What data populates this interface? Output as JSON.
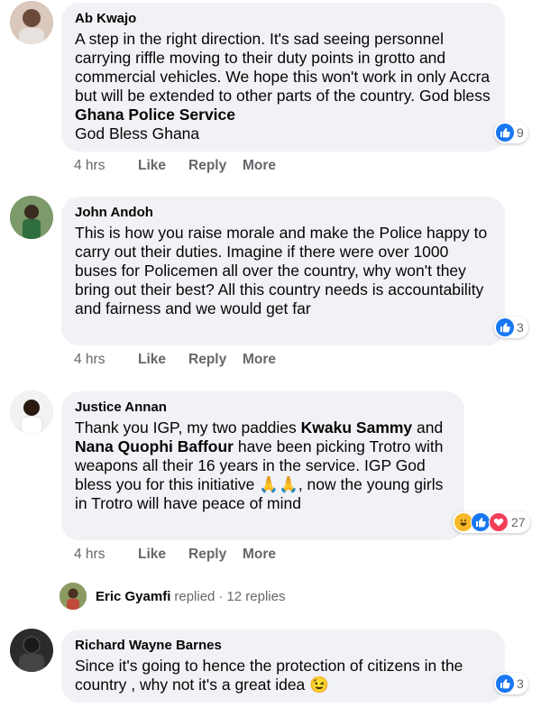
{
  "colors": {
    "accent": "#1877f2",
    "bubble": "#f0f2f5",
    "muted": "#65676b"
  },
  "action_labels": {
    "like": "Like",
    "reply": "Reply",
    "more": "More"
  },
  "comments": [
    {
      "author": "Ab Kwajo",
      "text_before": "A step in the right direction. It's sad seeing personnel carrying riffle moving to their duty points in grotto and commercial vehicles. We hope this won't work in only Accra but will be extended to other parts of the country. God bless ",
      "mention": "Ghana Police Service",
      "text_after": "God Bless Ghana",
      "time": "4 hrs",
      "reactions": [
        "like-reaction-icon"
      ],
      "reaction_count": "9"
    },
    {
      "author": "John Andoh",
      "text": "This is how you raise morale and make the Police happy to carry out their duties. Imagine if there were over 1000 buses for Policemen all over the country, why won't they bring out their best? All this country needs is accountability and fairness and we would get far",
      "time": "4 hrs",
      "reactions": [
        "like-reaction-icon"
      ],
      "reaction_count": "3"
    },
    {
      "author": "Justice Annan",
      "text_1": "Thank you IGP, my two paddies ",
      "mention_1": "Kwaku Sammy",
      "text_2": " and ",
      "mention_2": "Nana Quophi Baffour",
      "text_3": " have been picking Trotro with weapons all their 16 years in the service. IGP God bless you for this initiative 🙏🙏, now the young girls in Trotro will have peace of mind",
      "time": "4 hrs",
      "reactions": [
        "haha-reaction-icon",
        "like-reaction-icon",
        "love-reaction-icon"
      ],
      "reaction_count": "27"
    },
    {
      "author": "Richard Wayne Barnes",
      "text": "Since it's going to hence the protection of citizens in the country , why not it's a great idea 😉",
      "reactions": [
        "like-reaction-icon"
      ],
      "reaction_count": "3"
    }
  ],
  "reply_summary": {
    "name": "Eric Gyamfi",
    "verb": "replied",
    "dot": "·",
    "count": "12 replies"
  }
}
